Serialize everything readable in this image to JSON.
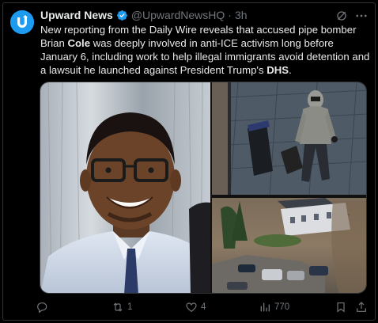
{
  "tweet": {
    "author_name": "Upward News",
    "handle": "@UpwardNewsHQ",
    "separator": "·",
    "time": "3h",
    "text_part1": "New reporting from the Daily Wire reveals that accused pipe bomber Brian ",
    "text_bold1": "Cole",
    "text_part2": " was deeply involved in anti-ICE activism long before January 6, including work to help illegal immigrants avoid detention and a lawsuit he launched against President Trump's ",
    "text_bold2": "DHS",
    "text_part3": "."
  },
  "icons": {
    "avatar": "upward-logo-icon",
    "verified": "verified-badge-icon",
    "grok": "grok-icon",
    "more": "more-icon",
    "reply": "reply-icon",
    "retweet": "retweet-icon",
    "like": "like-icon",
    "views": "views-icon",
    "bookmark": "bookmark-icon",
    "share": "share-icon"
  },
  "actions": {
    "reply_count": "",
    "retweet_count": "1",
    "like_count": "4",
    "views_count": "770"
  },
  "colors": {
    "background": "#000000",
    "accent": "#1d9bf0",
    "muted": "#71767b",
    "text": "#e7e9ea",
    "border": "#2f3336"
  }
}
